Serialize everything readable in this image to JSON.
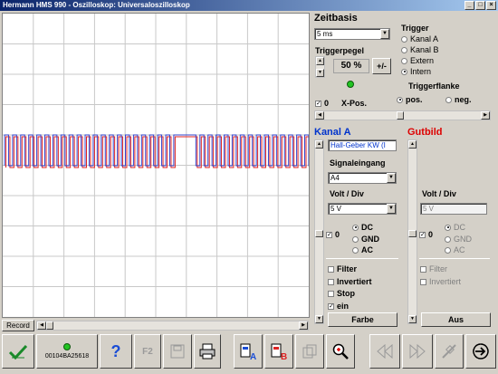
{
  "window": {
    "title": "Hermann HMS 990 - Oszilloskop: Universaloszilloskop"
  },
  "zeitbasis": {
    "heading": "Zeitbasis",
    "value": "5 ms",
    "triggerpegel_label": "Triggerpegel",
    "triggerpegel_value": "50 %",
    "sign_button": "+/-",
    "xpos_checkbox_value": "0",
    "xpos_label": "X-Pos."
  },
  "trigger": {
    "heading": "Trigger",
    "options": [
      "Kanal A",
      "Kanal B",
      "Extern",
      "Intern"
    ],
    "selected": "Intern",
    "flanke_label": "Triggerflanke",
    "flanke_options": [
      "pos.",
      "neg."
    ],
    "flanke_selected": "pos."
  },
  "kanal_a": {
    "heading": "Kanal A",
    "heading_color": "#0033cc",
    "sensor": "Hall-Geber KW (I",
    "signaleingang_label": "Signaleingang",
    "signaleingang_value": "A4",
    "volt_label": "Volt / Div",
    "volt_value": "5 V",
    "offset_value": "0",
    "coupling": [
      "DC",
      "GND",
      "AC"
    ],
    "coupling_selected": "DC",
    "checks": [
      {
        "label": "Filter",
        "checked": false
      },
      {
        "label": "Invertiert",
        "checked": false
      },
      {
        "label": "Stop",
        "checked": false
      },
      {
        "label": "ein",
        "checked": true
      }
    ],
    "button": "Farbe"
  },
  "gutbild": {
    "heading": "Gutbild",
    "heading_color": "#dd0000",
    "volt_label": "Volt / Div",
    "volt_value": "5 V",
    "offset_value": "0",
    "coupling": [
      "DC",
      "GND",
      "AC"
    ],
    "checks": [
      {
        "label": "Filter",
        "checked": false
      },
      {
        "label": "Invertiert",
        "checked": false
      }
    ],
    "button": "Aus"
  },
  "record": {
    "label": "Record"
  },
  "toolbar": {
    "device_id": "00104BA25618",
    "help": "?",
    "f2": "F2"
  },
  "colors": {
    "trace_a": "#3344cc",
    "trace_ref": "#dd2222",
    "grid": "#c8c8c8"
  }
}
